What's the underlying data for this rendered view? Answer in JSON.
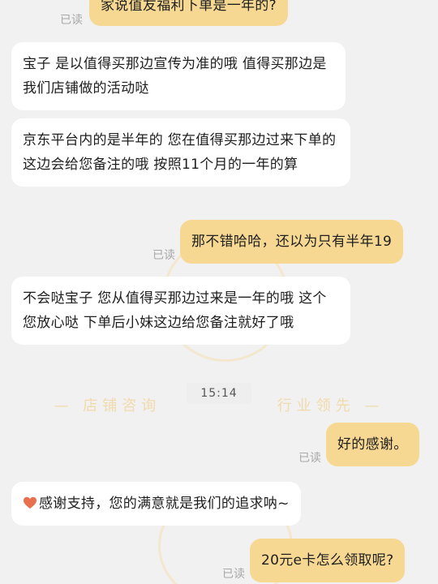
{
  "messages": [
    {
      "side": "out",
      "text": "家说值友福利下单是一年的?",
      "status": "已读"
    },
    {
      "side": "in",
      "text": "宝子  是以值得买那边宣传为准的哦  值得买那边是我们店铺做的活动哒"
    },
    {
      "side": "in",
      "text": "京东平台内的是半年的     您在值得买那边过来下单的这边会给您备注的哦  按照11个月的一年的算"
    },
    {
      "side": "out",
      "text": "那不错哈哈，还以为只有半年19",
      "status": "已读"
    },
    {
      "side": "in",
      "text": "不会哒宝子  您从值得买那边过来是一年的哦  这个您放心哒  下单后小妹这边给您备注就好了哦"
    },
    {
      "side": "out",
      "text": "好的感谢。",
      "status": "已读"
    },
    {
      "side": "in",
      "text": "感谢支持，您的满意就是我们的追求呐~",
      "icon": "heart-icon"
    },
    {
      "side": "out",
      "text": "20元e卡怎么领取呢?",
      "status": "已读"
    }
  ],
  "timestamp": "15:14",
  "watermark": {
    "left_fragment": "— 店铺咨询",
    "right_fragment": "行业领先 —"
  },
  "colors": {
    "outgoing_bubble": "#f6d892",
    "incoming_bubble": "#ffffff",
    "background": "#f1f1f1",
    "heart": "#e8704f"
  }
}
